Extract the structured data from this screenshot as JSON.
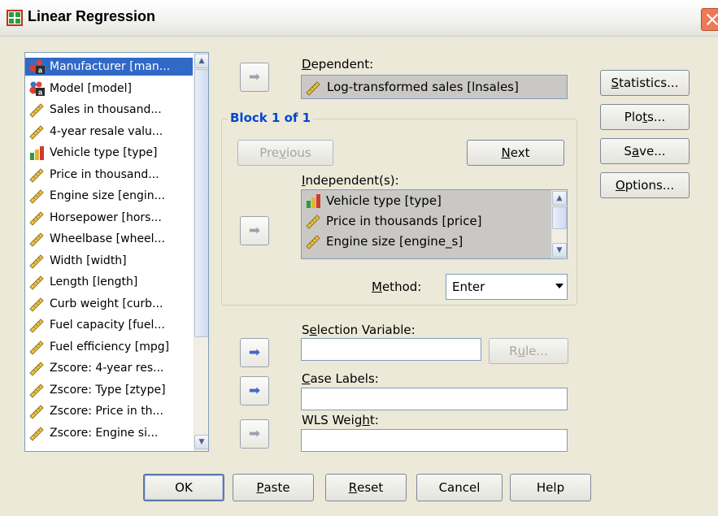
{
  "window": {
    "title": "Linear Regression",
    "close_label": "×"
  },
  "variables": [
    {
      "label": "Manufacturer [man...",
      "icon": "nominal-string-icon",
      "selected": true
    },
    {
      "label": "Model [model]",
      "icon": "nominal-string-icon"
    },
    {
      "label": "Sales in thousand...",
      "icon": "scale-ruler-icon"
    },
    {
      "label": "4-year resale valu...",
      "icon": "scale-ruler-icon"
    },
    {
      "label": "Vehicle type [type]",
      "icon": "nominal-bar-icon"
    },
    {
      "label": "Price in thousand...",
      "icon": "scale-ruler-icon"
    },
    {
      "label": "Engine size [engin...",
      "icon": "scale-ruler-icon"
    },
    {
      "label": "Horsepower [hors...",
      "icon": "scale-ruler-icon"
    },
    {
      "label": "Wheelbase [wheel...",
      "icon": "scale-ruler-icon"
    },
    {
      "label": "Width [width]",
      "icon": "scale-ruler-icon"
    },
    {
      "label": "Length [length]",
      "icon": "scale-ruler-icon"
    },
    {
      "label": "Curb weight [curb...",
      "icon": "scale-ruler-icon"
    },
    {
      "label": "Fuel capacity [fuel...",
      "icon": "scale-ruler-icon"
    },
    {
      "label": "Fuel efficiency [mpg]",
      "icon": "scale-ruler-icon"
    },
    {
      "label": "Zscore:  4-year res...",
      "icon": "scale-ruler-icon"
    },
    {
      "label": "Zscore:  Type [ztype]",
      "icon": "scale-ruler-icon"
    },
    {
      "label": "Zscore:  Price in th...",
      "icon": "scale-ruler-icon"
    },
    {
      "label": "Zscore:  Engine si...",
      "icon": "scale-ruler-icon"
    }
  ],
  "dependent": {
    "label_pre": "D",
    "label_rest": "ependent:",
    "value": "Log-transformed sales [lnsales]"
  },
  "block": {
    "title": "Block 1 of 1",
    "previous_pre": "Pre",
    "previous_u": "v",
    "previous_post": "ious",
    "next_u": "N",
    "next_rest": "ext"
  },
  "independents": {
    "label_pre": "I",
    "label_rest": "ndependent(s):",
    "items": [
      "Vehicle type [type]",
      "Price in thousands [price]",
      "Engine size [engine_s]"
    ]
  },
  "method": {
    "label_pre": "M",
    "label_rest": "ethod:",
    "value": "Enter"
  },
  "selection": {
    "label_pre": "S",
    "label_u": "e",
    "label_rest": "lection Variable:",
    "value": "",
    "rule_pre": "R",
    "rule_u": "u",
    "rule_rest": "le..."
  },
  "case_labels": {
    "label_u": "C",
    "label_rest": "ase Labels:",
    "value": ""
  },
  "wls": {
    "label_pre": "WLS Weig",
    "label_u": "h",
    "label_rest": "t:",
    "value": ""
  },
  "side_buttons": {
    "statistics": {
      "u": "S",
      "rest": "tatistics..."
    },
    "plots": {
      "pre": "Plo",
      "u": "t",
      "rest": "s..."
    },
    "save": {
      "pre": "S",
      "u": "a",
      "rest": "ve..."
    },
    "options": {
      "u": "O",
      "rest": "ptions..."
    }
  },
  "bottom_buttons": {
    "ok": "OK",
    "paste": {
      "u": "P",
      "rest": "aste"
    },
    "reset": {
      "u": "R",
      "rest": "eset"
    },
    "cancel": "Cancel",
    "help": "Help"
  },
  "arrow_glyph": "➡",
  "colors": {
    "selection": "#3169c6",
    "group_title": "#0046d5",
    "active_arrow": "#4566c9",
    "background": "#ece9d8"
  }
}
